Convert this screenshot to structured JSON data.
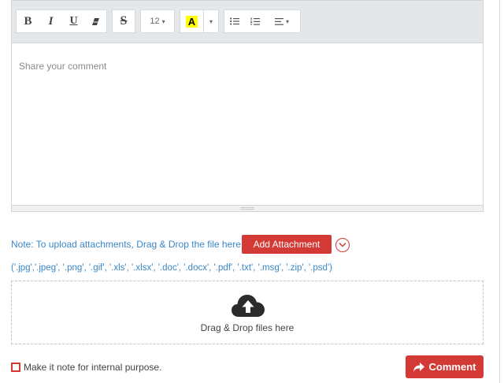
{
  "toolbar": {
    "bold": "B",
    "italic": "I",
    "underline": "U",
    "strike": "S",
    "font_size": "12",
    "highlight": "A",
    "caret": "▾",
    "icons": [
      "eraser-icon",
      "bullet-list-icon",
      "numbered-list-icon",
      "align-icon"
    ],
    "highlight_color": "#ffff00"
  },
  "editor": {
    "placeholder": "Share your comment"
  },
  "attachments": {
    "note": "Note: To upload attachments, Drag & Drop the file here",
    "add_button": "Add Attachment",
    "allowed_types": "('.jpg','.jpeg', '.png', '.gif', '.xls', '.xlsx', '.doc', '.docx', '.pdf', '.txt', '.msg', '.zip', '.psd')",
    "dropzone_text": "Drag & Drop files here",
    "dropzone_icon": "cloud-upload-icon"
  },
  "footer": {
    "internal_note_label": "Make it note for internal purpose.",
    "internal_note_checked": false,
    "comment_button": "Comment",
    "comment_icon": "share-arrow-icon"
  },
  "colors": {
    "accent": "#d43a35",
    "link": "#3a87c8",
    "toolbar_bg": "#e3e7ea"
  }
}
